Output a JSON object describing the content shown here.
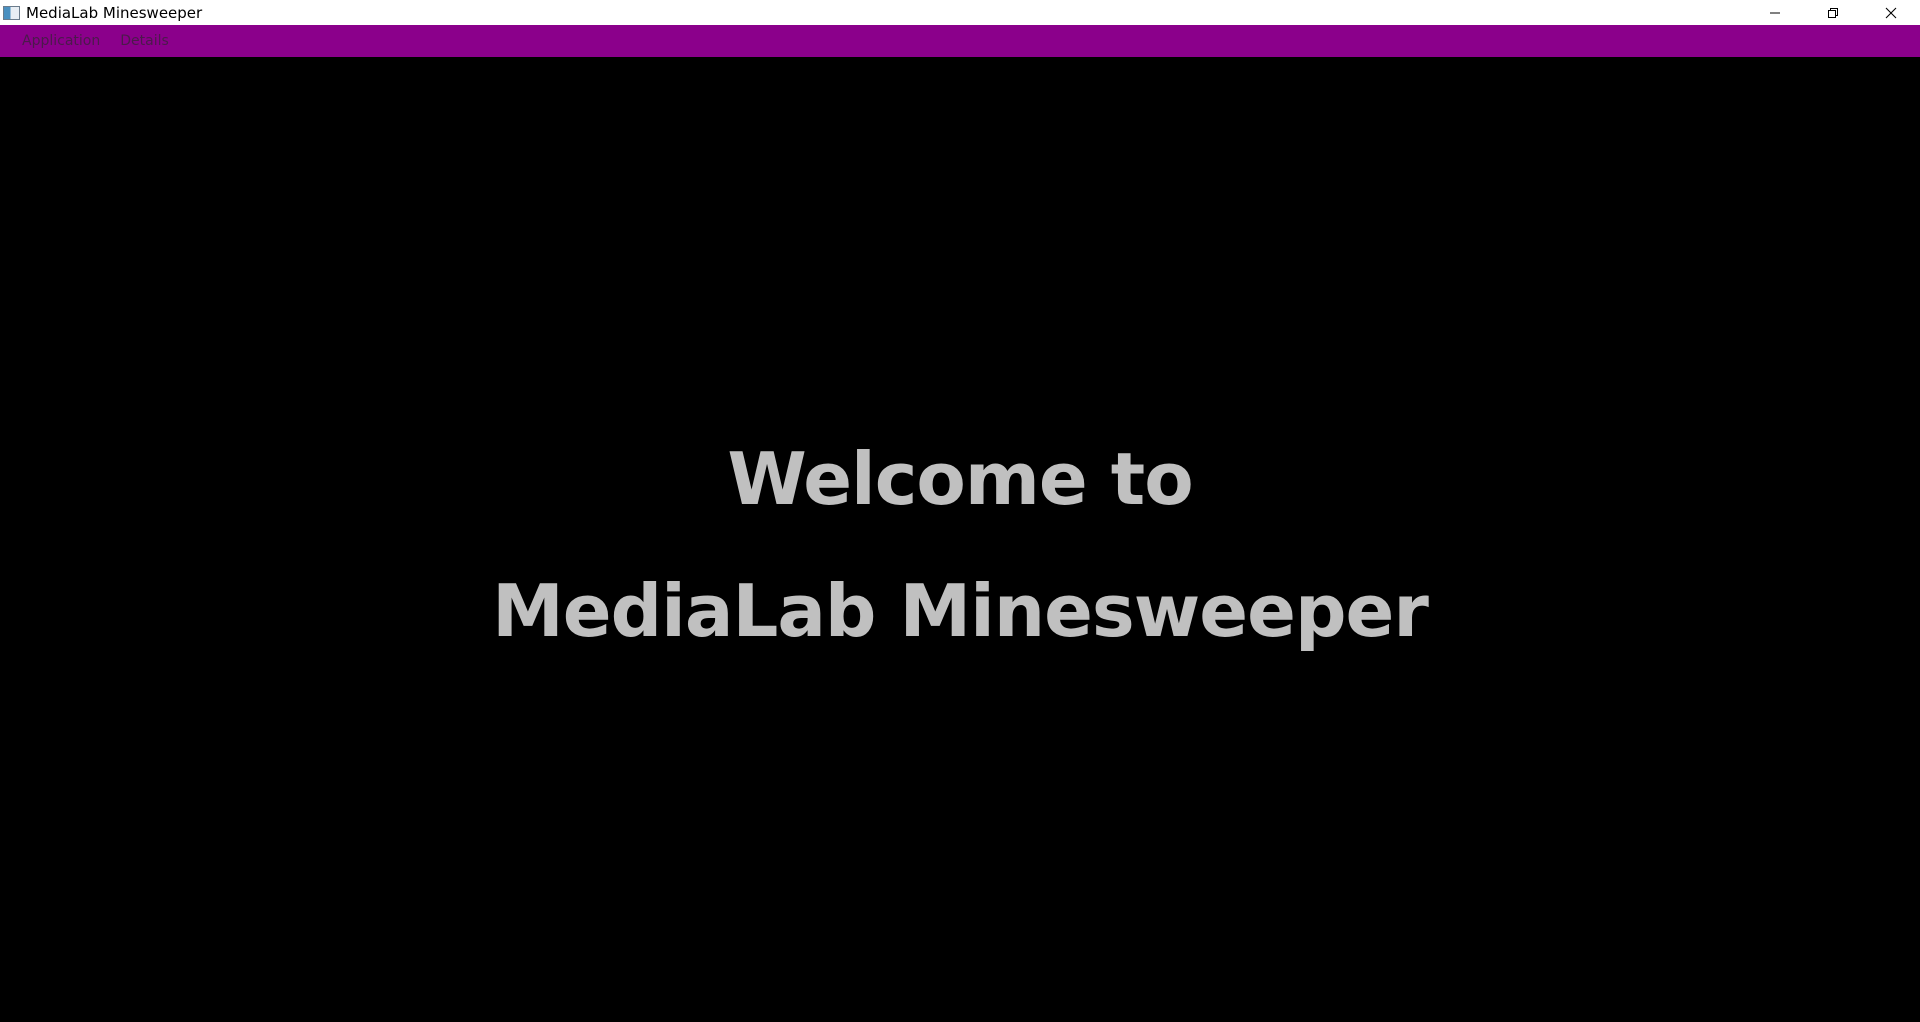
{
  "window": {
    "title": "MediaLab Minesweeper",
    "controls": {
      "minimize_icon": "minimize-icon",
      "maximize_icon": "restore-icon",
      "close_icon": "close-icon"
    }
  },
  "menubar": {
    "background": "#8b008b",
    "items": [
      {
        "label": "Application"
      },
      {
        "label": "Details"
      }
    ]
  },
  "main": {
    "welcome_line1": "Welcome to",
    "welcome_line2": "MediaLab Minesweeper",
    "text_color": "#c0c0c0",
    "background": "#000000"
  }
}
